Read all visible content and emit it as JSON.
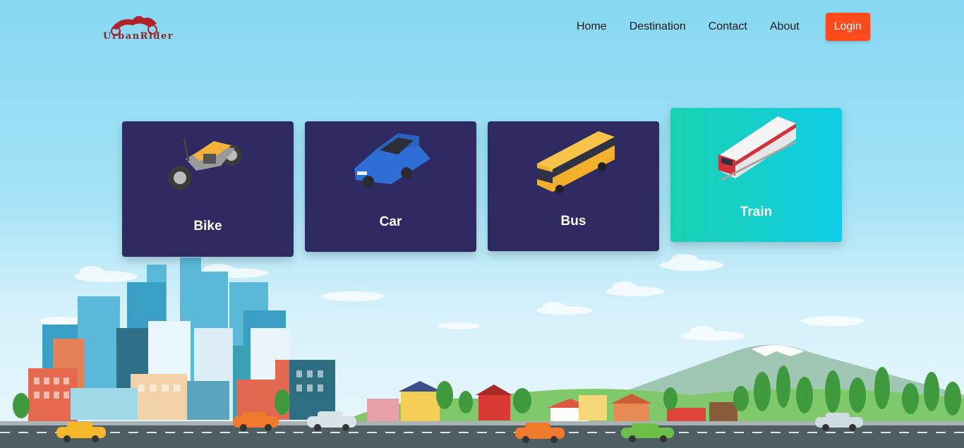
{
  "brand": {
    "name": "UrbanRider",
    "logo_icon": "motorcycle-logo-icon"
  },
  "nav": {
    "links": [
      "Home",
      "Destination",
      "Contact",
      "About"
    ],
    "login_label": "Login"
  },
  "cards": [
    {
      "label": "Bike",
      "icon": "motorcycle-icon",
      "active": false
    },
    {
      "label": "Car",
      "icon": "car-icon",
      "active": false
    },
    {
      "label": "Bus",
      "icon": "bus-icon",
      "active": false
    },
    {
      "label": "Train",
      "icon": "train-icon",
      "active": true
    }
  ],
  "colors": {
    "accent": "#ff4a1c",
    "card_bg": "#2e2961",
    "active_card": "#14d0cc",
    "brand_red": "#8a2329"
  }
}
